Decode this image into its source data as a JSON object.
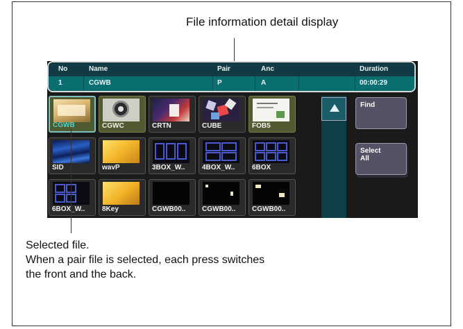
{
  "callouts": {
    "top": "File information detail display",
    "bottom_lines": [
      "Selected file.",
      "When a pair file is selected, each press switches",
      "the front and the back."
    ]
  },
  "info_table": {
    "headers": {
      "no": "No",
      "name": "Name",
      "pair": "Pair",
      "anc": "Anc",
      "duration": "Duration"
    },
    "row": {
      "no": "1",
      "name": "CGWB",
      "pair": "P",
      "anc": "A",
      "duration": "00:00:29"
    }
  },
  "files": [
    {
      "label": "CGWB",
      "thumb": "title-card",
      "selected": true
    },
    {
      "label": "CGWC",
      "thumb": "disc",
      "selected": false
    },
    {
      "label": "CRTN",
      "thumb": "scene",
      "selected": false
    },
    {
      "label": "CUBE",
      "thumb": "cube",
      "selected": false
    },
    {
      "label": "FOB5",
      "thumb": "paper",
      "selected": false
    },
    {
      "label": "SID",
      "thumb": "blue-waves",
      "selected": false
    },
    {
      "label": "wavP",
      "thumb": "gold",
      "selected": false
    },
    {
      "label": "3BOX_W..",
      "thumb": "boxes3",
      "selected": false
    },
    {
      "label": "4BOX_W..",
      "thumb": "boxes4",
      "selected": false
    },
    {
      "label": "6BOX",
      "thumb": "boxes6",
      "selected": false
    },
    {
      "label": "6BOX_W..",
      "thumb": "boxes6b",
      "selected": false
    },
    {
      "label": "8Key",
      "thumb": "gold2",
      "selected": false
    },
    {
      "label": "CGWB00..",
      "thumb": "black",
      "selected": false
    },
    {
      "label": "CGWB00..",
      "thumb": "black-bits",
      "selected": false
    },
    {
      "label": "CGWB00..",
      "thumb": "black-bits2",
      "selected": false
    }
  ],
  "buttons": {
    "find": "Find",
    "select_all_1": "Select",
    "select_all_2": "All"
  },
  "icons": {
    "scroll_up": "triangle-up-icon"
  },
  "colors": {
    "info_row": "#0b6f72",
    "selected_label": "#4fd2c8",
    "button_bg": "#575166"
  }
}
